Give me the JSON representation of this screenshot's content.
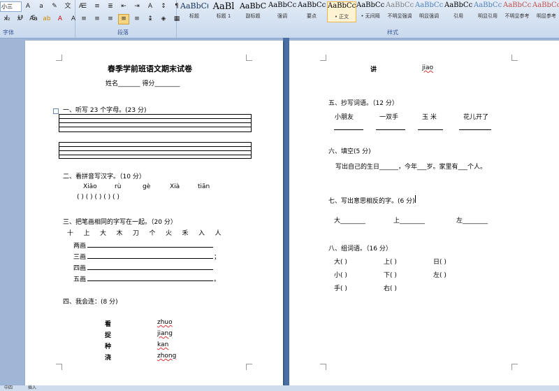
{
  "ribbon": {
    "font_size": "小三",
    "font_group_label": "字体",
    "para_group_label": "段落",
    "styles_group_label": "样式",
    "styles": [
      {
        "sample": "AaBbC(",
        "name": "标题"
      },
      {
        "sample": "AaBl",
        "name": "标题 1"
      },
      {
        "sample": "AaBbC",
        "name": "副标题"
      },
      {
        "sample": "AaBbCcD",
        "name": "强调"
      },
      {
        "sample": "AaBbCcD",
        "name": "要点"
      },
      {
        "sample": "AaBbCcD",
        "name": "• 正文"
      },
      {
        "sample": "AaBbCcD",
        "name": "• 无间隔"
      },
      {
        "sample": "AaBbCcD",
        "name": "不明显强调"
      },
      {
        "sample": "AaBbCcD",
        "name": "明显强调"
      },
      {
        "sample": "AaBbCcD",
        "name": "引用"
      },
      {
        "sample": "AaBbCcD",
        "name": "明显引用"
      },
      {
        "sample": "AaBbCcD",
        "name": "不明显参考"
      },
      {
        "sample": "AaBbCcI",
        "name": "明显参考"
      }
    ]
  },
  "left": {
    "title": "春季学前班语文期末试卷",
    "name_score": "姓名_______      得分________",
    "q1": "一、听写 23 个字母。(23 分)",
    "q2": "二、看拼音写汉字。（10 分）",
    "pinyin": [
      "Xiǎo",
      "rù",
      "gè",
      "Xià",
      "tiān"
    ],
    "brackets": "(      )    (      )   (      )   (      )   (      )",
    "q3": "三、把笔画相同的字写在一起。（20 分）",
    "chars": [
      "十",
      "上",
      "大",
      "木",
      "刀",
      "个",
      "火",
      "禾",
      "入",
      "人"
    ],
    "strokes": [
      "两画",
      "三画",
      "四画",
      "五画"
    ],
    "stroke_ends": [
      "",
      "；",
      "",
      "。"
    ],
    "q4": "四、我会连：(8 分)",
    "match_chars": [
      "看",
      "捉",
      "种",
      "浇"
    ],
    "match_pinyin": [
      "zhuo",
      "jiang",
      "kan",
      "zhong"
    ]
  },
  "right": {
    "top_char": "讲",
    "top_pinyin": "jiao",
    "q5": "五、抄写词语。（12 分）",
    "words": [
      "小朋友",
      "一双手",
      "玉  米",
      "花儿开了"
    ],
    "q6": "六、填空(5 分)",
    "fill": "写出自己的生日______，今年___岁。家里有___个人。",
    "q7": "七、写出意思相反的字。(6 分)",
    "opposites": [
      "大________",
      "上________",
      "左________"
    ],
    "q8": "八、组词语。（16 分）",
    "group_rows": [
      [
        "大(          )",
        "上(          )",
        "日(           )"
      ],
      [
        "小(          )",
        "下(          )",
        "左(           )"
      ],
      [
        "手(          )",
        "右(          )",
        ""
      ]
    ]
  },
  "status": {
    "page": "中四",
    "mode": "插入"
  }
}
